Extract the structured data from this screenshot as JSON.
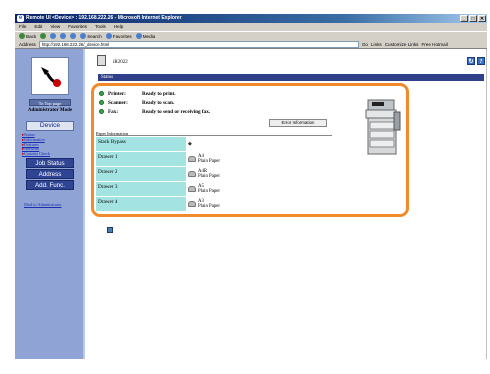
{
  "window": {
    "title": "Remote UI <Device> : 192.168.222.26 - Microsoft Internet Explorer",
    "controls": [
      "_",
      "□",
      "✕"
    ]
  },
  "menu": [
    "File",
    "Edit",
    "View",
    "Favorites",
    "Tools",
    "Help"
  ],
  "toolbar": {
    "back": "Back",
    "search": "Search",
    "favorites": "Favorites",
    "media": "Media"
  },
  "address": {
    "label": "Address",
    "url": "http://192.168.222.26/_device.html",
    "go": "Go",
    "links": "Links",
    "customize": "Customize Links",
    "hotmail": "Free Hotmail"
  },
  "sidebar": {
    "top_page": "To Top page",
    "mode": "Administrator Mode",
    "device": "Device",
    "device_links": [
      "Status",
      "Information",
      "Features",
      "Network",
      "Counter Check"
    ],
    "job_status": "Job Status",
    "address": "Address",
    "add_func": "Add. Func.",
    "mail": "Mail to Administrator"
  },
  "main": {
    "device_name": "iR2022",
    "section": "Status",
    "status": [
      {
        "label": "Printer:",
        "value": "Ready to print."
      },
      {
        "label": "Scanner:",
        "value": "Ready to scan."
      },
      {
        "label": "Fax:",
        "value": "Ready to send or receiving fax."
      }
    ],
    "error_button": "Error Information",
    "paper_header": "Paper Information",
    "paper": [
      {
        "source": "Stack Bypass",
        "size": "",
        "type": ""
      },
      {
        "source": "Drawer 1",
        "size": "A4",
        "type": "Plain Paper"
      },
      {
        "source": "Drawer 2",
        "size": "A4R",
        "type": "Plain Paper"
      },
      {
        "source": "Drawer 3",
        "size": "A5",
        "type": "Plain Paper"
      },
      {
        "source": "Drawer 4",
        "size": "A3",
        "type": "Plain Paper"
      }
    ]
  },
  "colors": {
    "highlight": "#f08a2a",
    "sidebar": "#8fa3d4",
    "nav_button": "#2f4593",
    "status_ok": "#3aa84a",
    "paper_cell": "#a3e3e1"
  }
}
